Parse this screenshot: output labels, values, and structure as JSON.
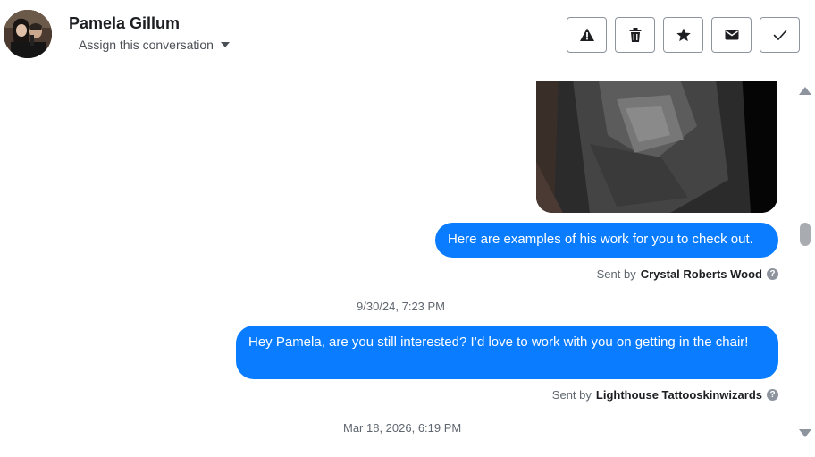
{
  "contact": {
    "name": "Pamela Gillum",
    "assign_label": "Assign this conversation"
  },
  "actions": [
    {
      "icon": "warning-icon",
      "label": "Spam"
    },
    {
      "icon": "trash-icon",
      "label": "Delete"
    },
    {
      "icon": "star-icon",
      "label": "Star"
    },
    {
      "icon": "envelope-icon",
      "label": "Mark as unread"
    },
    {
      "icon": "checkmark-icon",
      "label": "Mark as done"
    }
  ],
  "messages": [
    {
      "text": "Here are examples of his work for you to check out.",
      "sent_by_prefix": "Sent by",
      "sender": "Crystal Roberts Wood"
    },
    {
      "text": "Hey Pamela, are you still interested? I’d love to work with you on getting in the chair!",
      "sent_by_prefix": "Sent by",
      "sender": "Lighthouse Tattooskinwizards"
    }
  ],
  "timestamps": [
    "9/30/24, 7:23 PM",
    "Mar 18, 2026, 6:19 PM"
  ],
  "colors": {
    "bubble": "#0a7cff",
    "border": "#dddfe2",
    "muted_text": "#606770"
  }
}
